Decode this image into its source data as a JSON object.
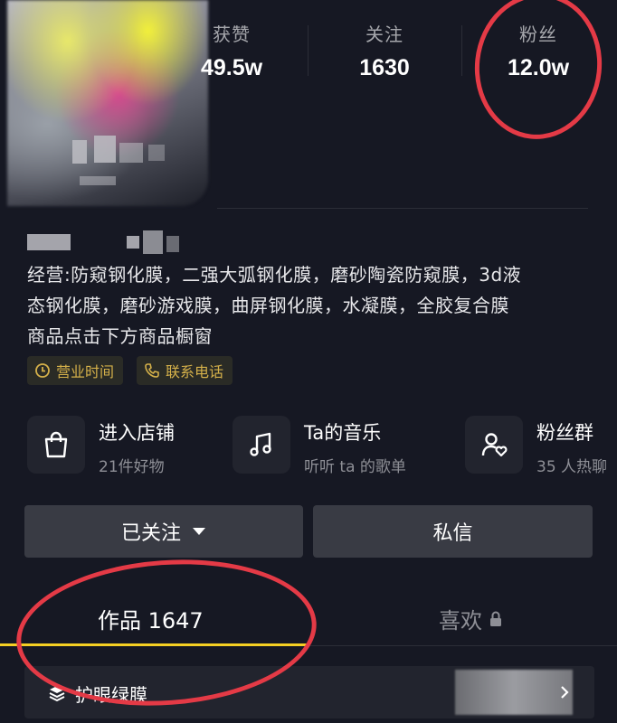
{
  "stats": [
    {
      "label": "获赞",
      "value": "49.5w"
    },
    {
      "label": "关注",
      "value": "1630"
    },
    {
      "label": "粉丝",
      "value": "12.0w"
    }
  ],
  "description": [
    "经营:防窥钢化膜，二强大弧钢化膜，磨砂陶瓷防窥膜，3d液",
    "态钢化膜，磨砂游戏膜，曲屏钢化膜，水凝膜，全胶复合膜",
    "商品点击下方商品橱窗"
  ],
  "tags": [
    {
      "label": "营业时间",
      "icon": "clock-icon"
    },
    {
      "label": "联系电话",
      "icon": "phone-icon"
    }
  ],
  "services": [
    {
      "title": "进入店铺",
      "subtitle": "21件好物",
      "icon": "shopping-bag-icon"
    },
    {
      "title": "Ta的音乐",
      "subtitle": "听听 ta 的歌单",
      "icon": "music-note-icon"
    },
    {
      "title": "粉丝群",
      "subtitle": "35 人热聊",
      "icon": "fan-group-icon"
    }
  ],
  "buttons": {
    "followed": "已关注",
    "message": "私信"
  },
  "tabs": {
    "works": "作品 1647",
    "likes": "喜欢"
  },
  "collection": {
    "label": "护眼绿膜"
  },
  "colors": {
    "background": "#161823",
    "accent": "#f5cf23",
    "tag_text": "#d4b04a",
    "annotation": "#e43a46"
  }
}
